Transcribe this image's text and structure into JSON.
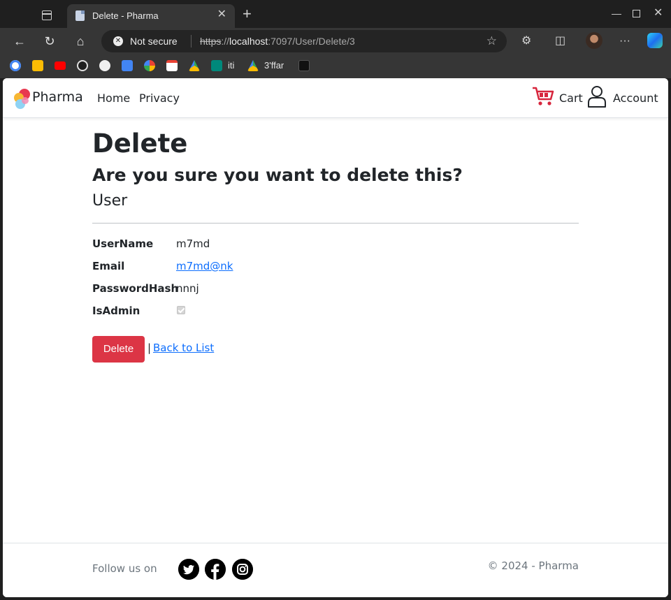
{
  "browser": {
    "tab_title": "Delete - Pharma",
    "security_label": "Not secure",
    "url_protocol": "https",
    "url_separator": "://",
    "url_host": "localhost",
    "url_path": ":7097/User/Delete/3",
    "bookmarks": [
      {
        "label": "",
        "icon": "google-icon",
        "color": "#ea4335"
      },
      {
        "label": "",
        "icon": "keep-icon",
        "color": "#fbbc04"
      },
      {
        "label": "",
        "icon": "youtube-icon",
        "color": "#ff0000"
      },
      {
        "label": "",
        "icon": "chatgpt-icon",
        "color": "#e0e0e0"
      },
      {
        "label": "",
        "icon": "github-icon",
        "color": "#f0f0f0"
      },
      {
        "label": "",
        "icon": "docs-icon",
        "color": "#4285f4"
      },
      {
        "label": "",
        "icon": "photos-icon",
        "color": "#34a853"
      },
      {
        "label": "",
        "icon": "gmail-icon",
        "color": "#ea4335"
      },
      {
        "label": "",
        "icon": "drive-icon",
        "color": "#fbbc04"
      },
      {
        "label": "iti",
        "icon": "meet-icon",
        "color": "#00897b"
      },
      {
        "label": "3'ffar",
        "icon": "drive-icon",
        "color": "#34a853"
      },
      {
        "label": "",
        "icon": "hackerrank-icon",
        "color": "#111111"
      }
    ]
  },
  "navbar": {
    "brand": "Pharma",
    "links": [
      "Home",
      "Privacy"
    ],
    "cart_label": "Cart",
    "account_label": "Account"
  },
  "page": {
    "title": "Delete",
    "question": "Are you sure you want to delete this?",
    "entity": "User",
    "fields": [
      {
        "label": "UserName",
        "value": "m7md"
      },
      {
        "label": "Email",
        "value": "m7md@nk"
      },
      {
        "label": "PasswordHash",
        "value": "nnnj"
      },
      {
        "label": "IsAdmin",
        "value": true
      }
    ],
    "delete_button": "Delete",
    "separator": "|",
    "back_link": "Back to List"
  },
  "footer": {
    "follow_text": "Follow us on",
    "social": [
      "twitter-icon",
      "facebook-icon",
      "instagram-icon"
    ],
    "copyright": "© 2024 - Pharma"
  },
  "colors": {
    "danger": "#dc3545",
    "link": "#0d6efd",
    "muted": "#6c757d",
    "cart_red": "#d7263d"
  }
}
